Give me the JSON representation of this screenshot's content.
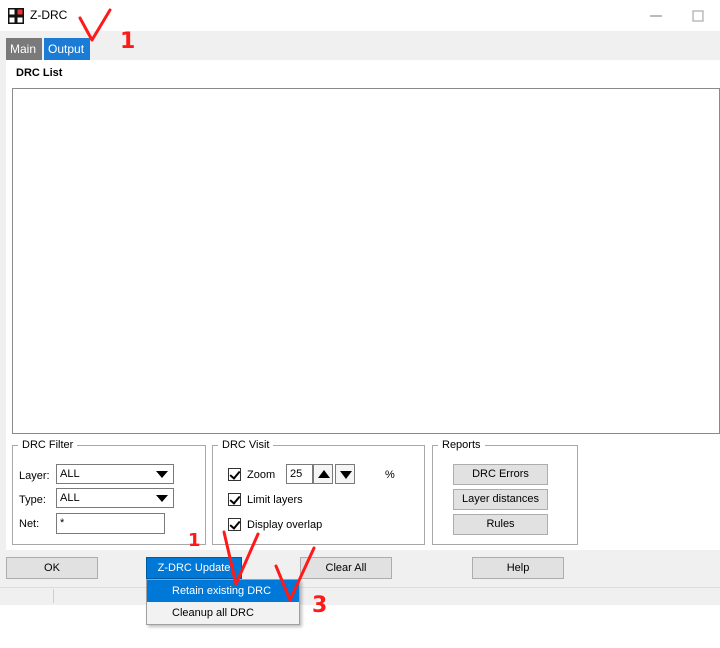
{
  "window": {
    "title": "Z-DRC"
  },
  "tabs": [
    {
      "label": "Main"
    },
    {
      "label": "Output"
    }
  ],
  "drc_list": {
    "label": "DRC List"
  },
  "drc_filter": {
    "title": "DRC Filter",
    "layer_label": "Layer:",
    "layer_value": "ALL",
    "type_label": "Type:",
    "type_value": "ALL",
    "net_label": "Net:",
    "net_value": "*"
  },
  "drc_visit": {
    "title": "DRC Visit",
    "zoom_label": "Zoom",
    "zoom_value": "25",
    "zoom_unit": "%",
    "zoom_checked": true,
    "limit_layers_label": "Limit layers",
    "limit_layers_checked": true,
    "display_overlap_label": "Display overlap",
    "display_overlap_checked": true
  },
  "reports": {
    "title": "Reports",
    "buttons": [
      {
        "label": "DRC Errors"
      },
      {
        "label": "Layer distances"
      },
      {
        "label": "Rules"
      }
    ]
  },
  "buttons": {
    "ok": "OK",
    "update": "Z-DRC Update",
    "clear_all": "Clear All",
    "help": "Help"
  },
  "update_menu": {
    "items": [
      {
        "label": "Retain existing DRC",
        "highlighted": true
      },
      {
        "label": "Cleanup all DRC"
      }
    ]
  },
  "annotations": {
    "mark1": "1",
    "mark2": "1",
    "mark3": "3",
    "color": "#ff1a1a"
  },
  "colors": {
    "accent": "#0078d7",
    "tab_active": "#1c7bd4",
    "tab_inactive": "#7a7a7a"
  }
}
